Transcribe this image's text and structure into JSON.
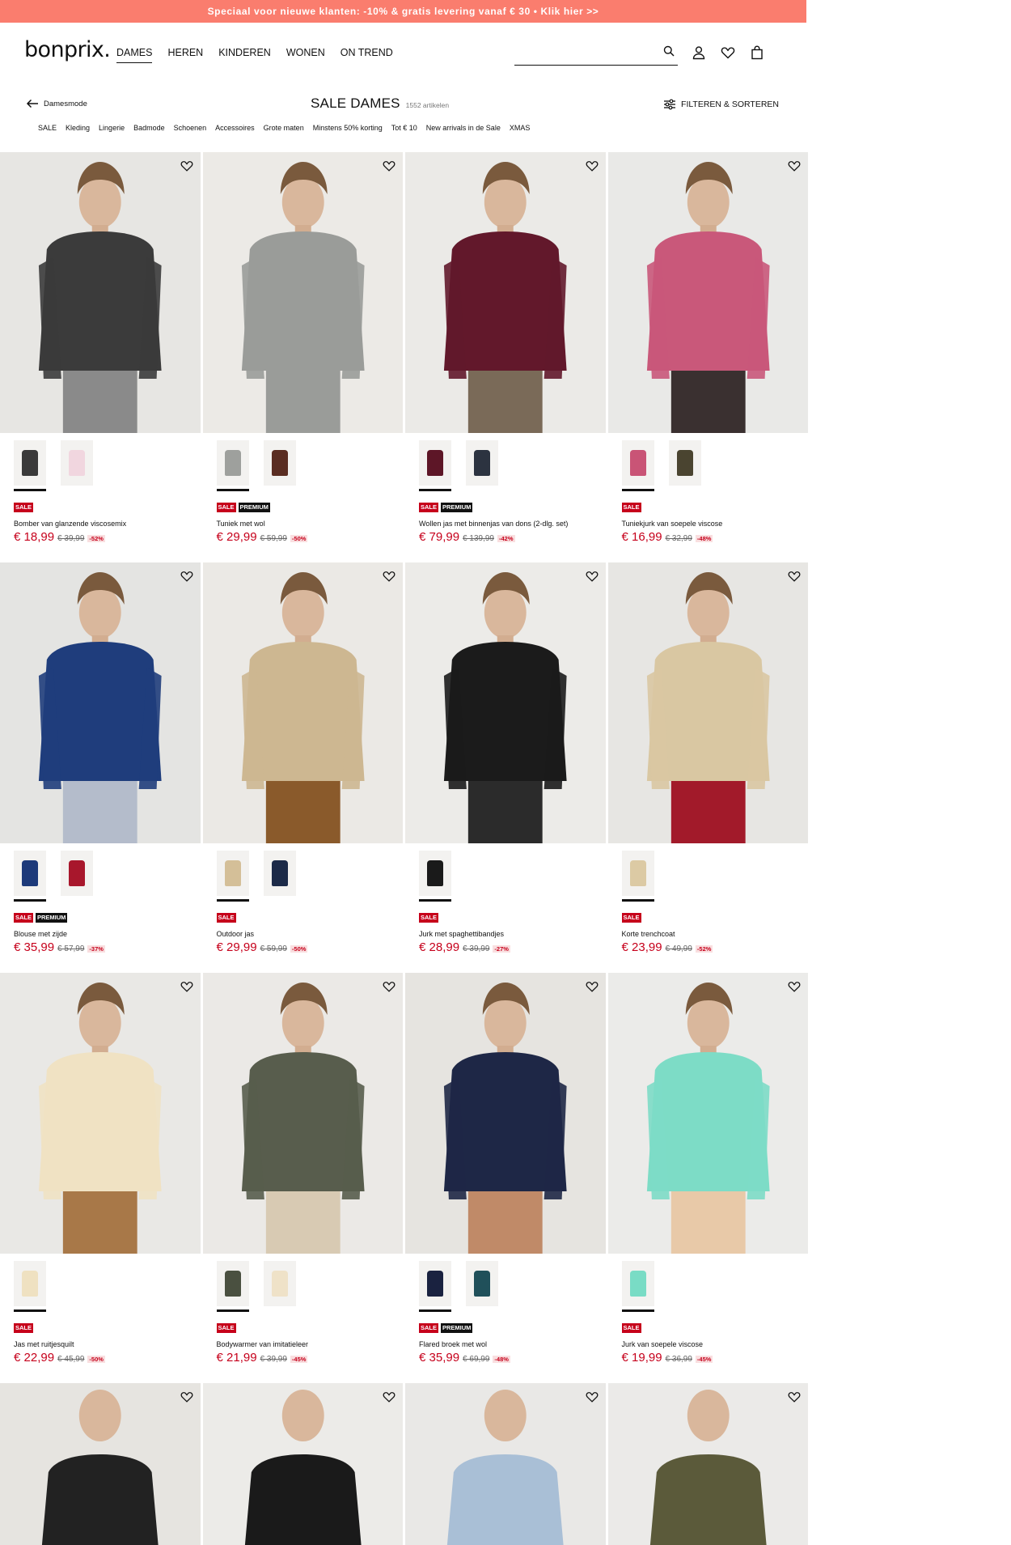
{
  "promo": "Speciaal voor nieuwe klanten: -10% & gratis levering vanaf € 30 • Klik hier >>",
  "header": {
    "logo": "bonprix.",
    "nav": [
      "DAMES",
      "HEREN",
      "KINDEREN",
      "WONEN",
      "ON TREND"
    ],
    "active_nav": "DAMES",
    "search_placeholder": "",
    "icons": [
      "search-icon",
      "account-icon",
      "wishlist-icon",
      "bag-icon"
    ]
  },
  "category": {
    "back_label": "Damesmode",
    "title": "SALE DAMES",
    "count": "1552 artikelen",
    "filter_label": "FILTEREN & SORTEREN",
    "subnav": [
      "SALE",
      "Kleding",
      "Lingerie",
      "Badmode",
      "Schoenen",
      "Accessoires",
      "Grote maten",
      "Minstens 50% korting",
      "Tot € 10",
      "New arrivals in de Sale",
      "XMAS"
    ]
  },
  "colors": {
    "promo_bg": "#fa7d6e",
    "sale_red": "#c6001b",
    "premium_black": "#111111"
  },
  "products": [
    {
      "name": "Bomber van glanzende viscosemix",
      "price": "€ 18,99",
      "old": "€ 39,99",
      "pct": "-52%",
      "badges": [
        "SALE"
      ],
      "swatches": [
        "#3a3a3a",
        "#f1d6df"
      ],
      "bg": "#e7e6e3",
      "main": "#3b3b3b",
      "accent": "#8a8a8a"
    },
    {
      "name": "Tuniek met wol",
      "price": "€ 29,99",
      "old": "€ 59,99",
      "pct": "-50%",
      "badges": [
        "SALE",
        "PREMIUM"
      ],
      "swatches": [
        "#9ea09d",
        "#5a2d22"
      ],
      "bg": "#eceae6",
      "main": "#9a9c99",
      "accent": "#9a9c99"
    },
    {
      "name": "Wollen jas met binnenjas van dons (2-dlg. set)",
      "price": "€ 79,99",
      "old": "€ 139,99",
      "pct": "-42%",
      "badges": [
        "SALE",
        "PREMIUM"
      ],
      "swatches": [
        "#5d1627",
        "#2c3340"
      ],
      "bg": "#ebeae7",
      "main": "#62182b",
      "accent": "#7a6a58"
    },
    {
      "name": "Tuniekjurk van soepele viscose",
      "price": "€ 16,99",
      "old": "€ 32,99",
      "pct": "-48%",
      "badges": [
        "SALE"
      ],
      "swatches": [
        "#c95476",
        "#4a4430"
      ],
      "bg": "#e9e9e7",
      "main": "#c9587a",
      "accent": "#3a3030"
    },
    {
      "name": "Blouse met zijde",
      "price": "€ 35,99",
      "old": "€ 57,99",
      "pct": "-37%",
      "badges": [
        "SALE",
        "PREMIUM"
      ],
      "swatches": [
        "#1d3a7a",
        "#a8172c"
      ],
      "bg": "#e4e4e2",
      "main": "#1f3d7c",
      "accent": "#b4bccb"
    },
    {
      "name": "Outdoor jas",
      "price": "€ 29,99",
      "old": "€ 59,99",
      "pct": "-50%",
      "badges": [
        "SALE"
      ],
      "swatches": [
        "#d4bf98",
        "#1c2a48"
      ],
      "bg": "#ebe9e5",
      "main": "#cdb791",
      "accent": "#8a5a2b"
    },
    {
      "name": "Jurk met spaghettibandjes",
      "price": "€ 28,99",
      "old": "€ 39,99",
      "pct": "-27%",
      "badges": [
        "SALE"
      ],
      "swatches": [
        "#1a1a1a"
      ],
      "bg": "#ecebe8",
      "main": "#1b1b1b",
      "accent": "#2b2b2b"
    },
    {
      "name": "Korte trenchcoat",
      "price": "€ 23,99",
      "old": "€ 49,99",
      "pct": "-52%",
      "badges": [
        "SALE"
      ],
      "swatches": [
        "#dccaa4"
      ],
      "bg": "#e7e6e3",
      "main": "#d9c7a2",
      "accent": "#a21a2a"
    },
    {
      "name": "Jas met ruitjesquilt",
      "price": "€ 22,99",
      "old": "€ 45,99",
      "pct": "-50%",
      "badges": [
        "SALE"
      ],
      "swatches": [
        "#efe1c1"
      ],
      "bg": "#e9e8e5",
      "main": "#f0e2c3",
      "accent": "#a87848"
    },
    {
      "name": "Bodywarmer van imitatieleer",
      "price": "€ 21,99",
      "old": "€ 39,99",
      "pct": "-45%",
      "badges": [
        "SALE"
      ],
      "swatches": [
        "#4a5040",
        "#efe2c8"
      ],
      "bg": "#ebe9e6",
      "main": "#585d4d",
      "accent": "#d8cab3"
    },
    {
      "name": "Flared broek met wol",
      "price": "€ 35,99",
      "old": "€ 69,99",
      "pct": "-48%",
      "badges": [
        "SALE",
        "PREMIUM"
      ],
      "swatches": [
        "#1a2240",
        "#20505a"
      ],
      "bg": "#e6e4e0",
      "main": "#1e2746",
      "accent": "#c08a68"
    },
    {
      "name": "Jurk van soepele viscose",
      "price": "€ 19,99",
      "old": "€ 36,99",
      "pct": "-45%",
      "badges": [
        "SALE"
      ],
      "swatches": [
        "#79dcc5"
      ],
      "bg": "#ebebe9",
      "main": "#7ddcc6",
      "accent": "#e8c9a8"
    }
  ],
  "partial_row": [
    {
      "bg": "#e6e4e0",
      "main": "#222222"
    },
    {
      "bg": "#ecebe8",
      "main": "#1a1a1a"
    },
    {
      "bg": "#e9e8e6",
      "main": "#a9bfd6"
    },
    {
      "bg": "#ebeae8",
      "main": "#5b5a3a"
    }
  ]
}
